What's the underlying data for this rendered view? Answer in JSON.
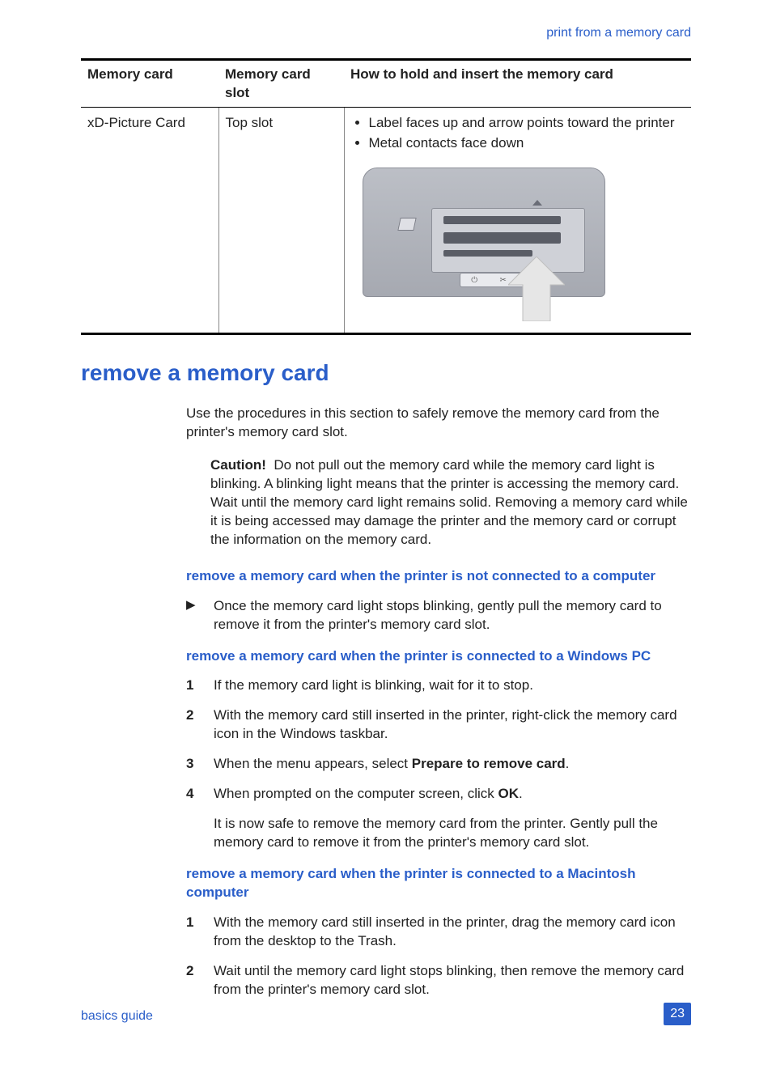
{
  "header": {
    "chapter_link": "print from a memory card"
  },
  "table": {
    "headers": [
      "Memory card",
      "Memory card slot",
      "How to hold and insert the memory card"
    ],
    "row": {
      "card": "xD-Picture Card",
      "slot": "Top slot",
      "bullets": [
        "Label faces up and arrow points toward the printer",
        "Metal contacts face down"
      ]
    }
  },
  "section_title": "remove a memory card",
  "intro": "Use the procedures in this section to safely remove the memory card from the printer's memory card slot.",
  "caution": {
    "label": "Caution!",
    "text": "Do not pull out the memory card while the memory card light is blinking. A blinking light means that the printer is accessing the memory card. Wait until the memory card light remains solid. Removing a memory card while it is being accessed may damage the printer and the memory card or corrupt the information on the memory card."
  },
  "sub1": {
    "heading": "remove a memory card when the printer is not connected to a computer",
    "item": "Once the memory card light stops blinking, gently pull the memory card to remove it from the printer's memory card slot."
  },
  "sub2": {
    "heading": "remove a memory card when the printer is connected to a Windows PC",
    "steps": [
      "If the memory card light is blinking, wait for it to stop.",
      "With the memory card still inserted in the printer, right-click the memory card icon in the Windows taskbar.",
      "When the menu appears, select ",
      "When prompted on the computer screen, click "
    ],
    "step3_bold": "Prepare to remove card",
    "step4_bold": "OK",
    "after": "It is now safe to remove the memory card from the printer. Gently pull the memory card to remove it from the printer's memory card slot."
  },
  "sub3": {
    "heading": "remove a memory card when the printer is connected to a Macintosh computer",
    "steps": [
      "With the memory card still inserted in the printer, drag the memory card icon from the desktop to the Trash.",
      "Wait until the memory card light stops blinking, then remove the memory card from the printer's memory card slot."
    ]
  },
  "footer": {
    "doc_title": "basics guide",
    "page": "23"
  }
}
